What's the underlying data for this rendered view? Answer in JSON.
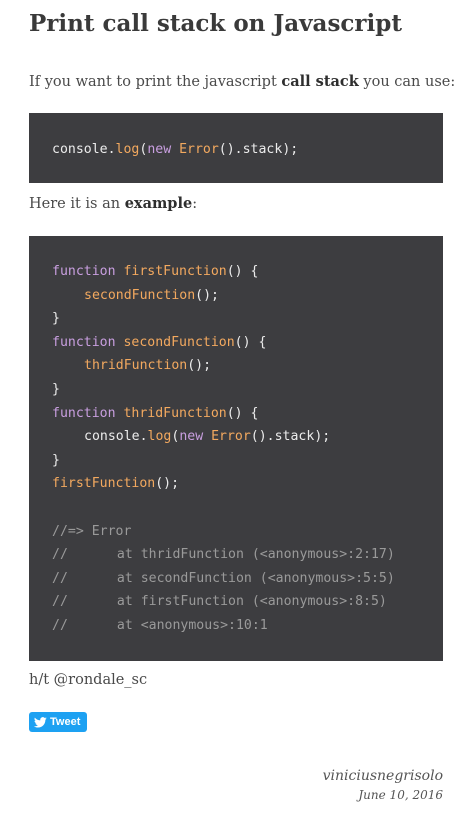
{
  "post": {
    "title": "Print call stack on Javascript",
    "intro": {
      "before": "If you want to print the javascript ",
      "bold": "call stack",
      "after": " you can use:"
    },
    "example_intro": {
      "before": "Here it is an ",
      "bold": "example",
      "after": ":"
    },
    "code_snippet_1": [
      [
        [
          "plain",
          "console."
        ],
        [
          "fn",
          "log"
        ],
        [
          "plain",
          "("
        ],
        [
          "kw",
          "new"
        ],
        [
          "plain",
          " "
        ],
        [
          "fn",
          "Error"
        ],
        [
          "plain",
          "().stack);"
        ]
      ]
    ],
    "code_snippet_2": [
      [
        [
          "kw",
          "function"
        ],
        [
          "plain",
          " "
        ],
        [
          "fn",
          "firstFunction"
        ],
        [
          "plain",
          "() {"
        ]
      ],
      [
        [
          "indent",
          ""
        ],
        [
          "fn",
          "secondFunction"
        ],
        [
          "plain",
          "();"
        ]
      ],
      [
        [
          "plain",
          "}"
        ]
      ],
      [
        [
          "kw",
          "function"
        ],
        [
          "plain",
          " "
        ],
        [
          "fn",
          "secondFunction"
        ],
        [
          "plain",
          "() {"
        ]
      ],
      [
        [
          "indent",
          ""
        ],
        [
          "fn",
          "thridFunction"
        ],
        [
          "plain",
          "();"
        ]
      ],
      [
        [
          "plain",
          "}"
        ]
      ],
      [
        [
          "kw",
          "function"
        ],
        [
          "plain",
          " "
        ],
        [
          "fn",
          "thridFunction"
        ],
        [
          "plain",
          "() {"
        ]
      ],
      [
        [
          "indent",
          ""
        ],
        [
          "plain",
          "console."
        ],
        [
          "fn",
          "log"
        ],
        [
          "plain",
          "("
        ],
        [
          "kw",
          "new"
        ],
        [
          "plain",
          " "
        ],
        [
          "fn",
          "Error"
        ],
        [
          "plain",
          "().stack);"
        ]
      ],
      [
        [
          "plain",
          "}"
        ]
      ],
      [
        [
          "fn",
          "firstFunction"
        ],
        [
          "plain",
          "();"
        ]
      ],
      [
        [
          "plain",
          ""
        ]
      ],
      [
        [
          "cm",
          "//=> Error"
        ]
      ],
      [
        [
          "cm",
          "//"
        ],
        [
          "indent2",
          ""
        ],
        [
          "cm",
          "at thridFunction (<anonymous>:2:17)"
        ]
      ],
      [
        [
          "cm",
          "//"
        ],
        [
          "indent2",
          ""
        ],
        [
          "cm",
          "at secondFunction (<anonymous>:5:5)"
        ]
      ],
      [
        [
          "cm",
          "//"
        ],
        [
          "indent2",
          ""
        ],
        [
          "cm",
          "at firstFunction (<anonymous>:8:5)"
        ]
      ],
      [
        [
          "cm",
          "//"
        ],
        [
          "indent2",
          ""
        ],
        [
          "cm",
          "at <anonymous>:10:1"
        ]
      ]
    ],
    "hat_tip": "h/t @rondale_sc",
    "tweet_label": "Tweet",
    "author": "viniciusnegrisolo",
    "date": "June 10, 2016"
  },
  "colors": {
    "code_background": "#3d3d40",
    "keyword": "#c99fe0",
    "function": "#f3a95f",
    "comment": "#9a9a9a",
    "tweet_button": "#1da1f2"
  },
  "icons": {
    "tweet": "twitter-bird-icon"
  }
}
